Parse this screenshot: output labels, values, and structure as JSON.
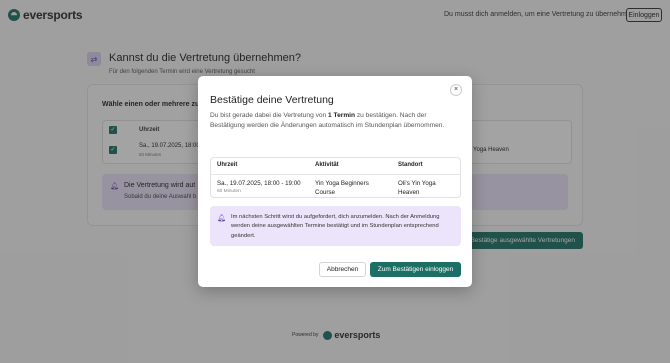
{
  "header": {
    "brand": "eversports",
    "login_hint": "Du musst dich anmelden, um eine Vertretung zu übernehmen",
    "login_button": "Einloggen"
  },
  "page": {
    "title": "Kannst du die Vertretung übernehmen?",
    "subtitle": "Für den folgenden Termin wird eine Vertretung gesucht",
    "card_heading": "Wähle einen oder mehrere zu",
    "table": {
      "col_time": "Uhrzeit",
      "col_location_partial": "rt",
      "row_time": "Sa., 19.07.2025, 18:00",
      "row_duration": "60 Minuten",
      "row_location_partial": "Yoga Heaven"
    },
    "notice_title": "Die Vertretung wird aut",
    "notice_text": "Sobald du deine Auswahl b",
    "confirm_button": "Bestätige ausgewählte Vertretungen"
  },
  "footer": {
    "powered_by": "Powered by",
    "brand": "eversports"
  },
  "modal": {
    "close_icon": "×",
    "title": "Bestätige deine Vertretung",
    "desc_before": "Du bist gerade dabei die Vertretung von ",
    "desc_bold": "1 Termin",
    "desc_after": " zu bestätigen. Nach der Bestätigung werden die Änderungen automatisch im Stundenplan übernommen.",
    "table": {
      "headers": [
        "Uhrzeit",
        "Aktivität",
        "Standort"
      ],
      "row": {
        "time": "Sa., 19.07.2025, 18:00 - 19:00",
        "duration": "60 Minuten",
        "activity": "Yin Yoga Beginners Course",
        "location": "Oli's Yin Yoga Heaven"
      }
    },
    "notice": "Im nächsten Schritt wirst du aufgefordert, dich anzumelden. Nach der Anmeldung werden deine ausgewählten Termine bestätigt und im Stundenplan entsprechend geändert.",
    "cancel_button": "Abbrechen",
    "login_button": "Zum Bestätigen einloggen"
  },
  "colors": {
    "brand_green": "#1c6f64",
    "notice_purple": "#ece4fa",
    "icon_purple": "#5a3fb0"
  },
  "icons": {
    "brand": "eversports-logo-icon",
    "swap": "swap-icon",
    "bell": "bell-icon",
    "close": "close-icon",
    "check": "checkbox-checked-icon"
  }
}
